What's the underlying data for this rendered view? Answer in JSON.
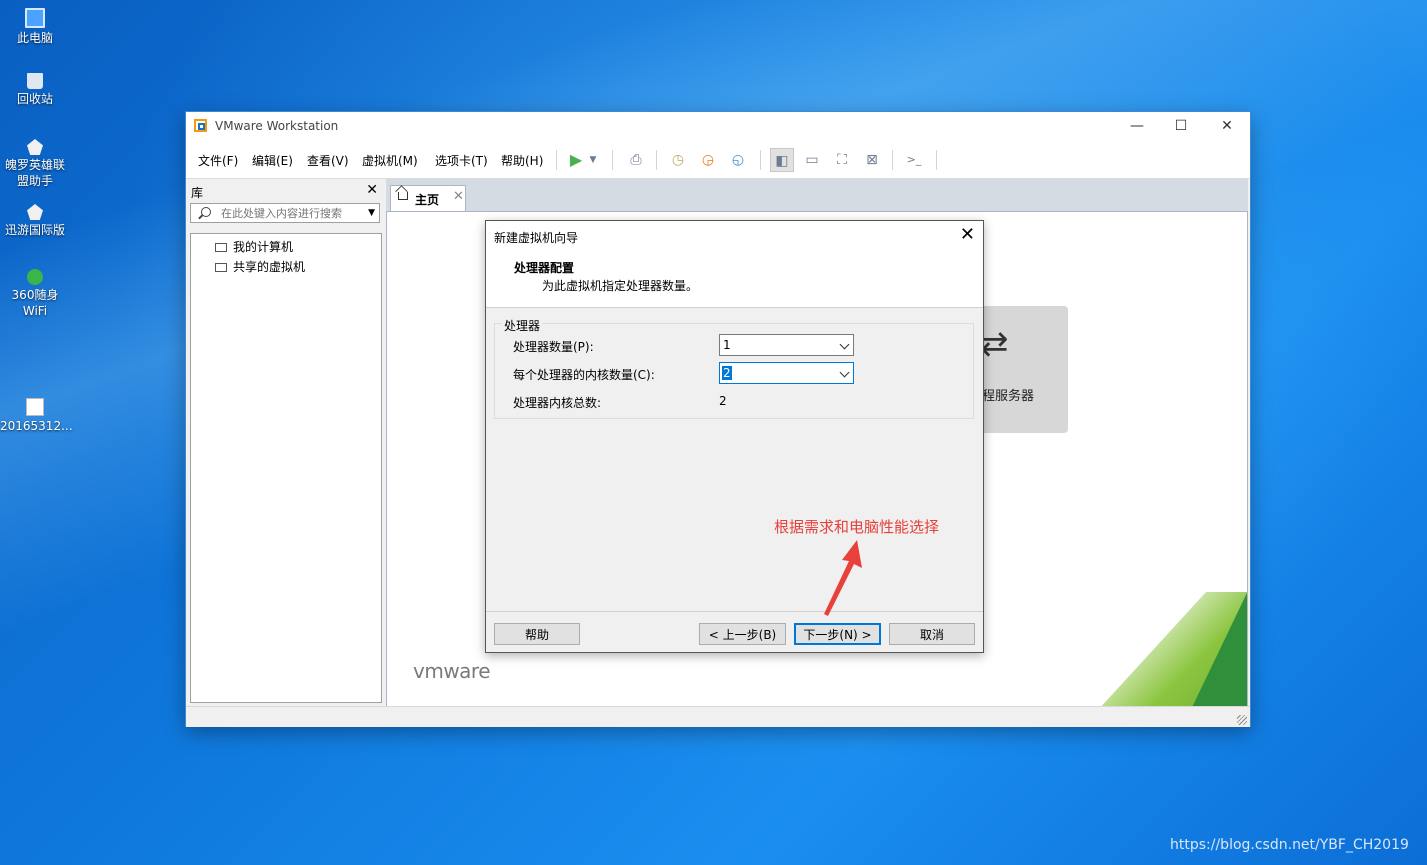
{
  "desktop": {
    "icons": [
      {
        "label": "此电脑",
        "icon": "computer-icon"
      },
      {
        "label": "回收站",
        "icon": "recycle-bin-icon"
      },
      {
        "label": "魄罗英雄联盟助手",
        "label_line1": "魄罗英雄联",
        "label_line2": "盟助手",
        "icon": "game-assistant-icon"
      },
      {
        "label": "迅游国际版",
        "icon": "xunyou-icon"
      },
      {
        "label": "360随身WiFi",
        "icon": "wifi-icon"
      },
      {
        "label": "20165312...",
        "icon": "file-icon"
      }
    ],
    "watermark": "https://blog.csdn.net/YBF_CH2019"
  },
  "window": {
    "title": "VMware Workstation",
    "controls": {
      "minimize": "—",
      "maximize": "☐",
      "close": "✕"
    },
    "menu": [
      "文件(F)",
      "编辑(E)",
      "查看(V)",
      "虚拟机(M)",
      "选项卡(T)",
      "帮助(H)"
    ],
    "toolbar_icons": [
      "play-icon",
      "dropdown-icon",
      "send-keys-icon",
      "snapshot-icon",
      "revert-snapshot-icon",
      "manage-snapshots-icon",
      "library-view-icon",
      "thumbnail-bar-icon",
      "fullscreen-icon",
      "unity-icon",
      "console-icon"
    ],
    "library": {
      "title": "库",
      "close": "✕",
      "search_placeholder": "在此处键入内容进行搜索",
      "items": [
        "我的计算机",
        "共享的虚拟机"
      ]
    },
    "tab": {
      "label": "主页",
      "close": "✕"
    },
    "home": {
      "remote_card_label": "程服务器",
      "remote_card_icon": "⇄",
      "logo": "vmware"
    }
  },
  "wizard": {
    "title": "新建虚拟机向导",
    "close": "✕",
    "heading": "处理器配置",
    "subheading": "为此虚拟机指定处理器数量。",
    "group_label": "处理器",
    "processor_count_label": "处理器数量(P):",
    "processor_count_value": "1",
    "cores_per_processor_label": "每个处理器的内核数量(C):",
    "cores_per_processor_value": "2",
    "total_cores_label": "处理器内核总数:",
    "total_cores_value": "2",
    "buttons": {
      "help": "帮助",
      "back": "< 上一步(B)",
      "next": "下一步(N) >",
      "cancel": "取消"
    }
  },
  "annotation": {
    "text": "根据需求和电脑性能选择",
    "color": "#e8403b"
  }
}
